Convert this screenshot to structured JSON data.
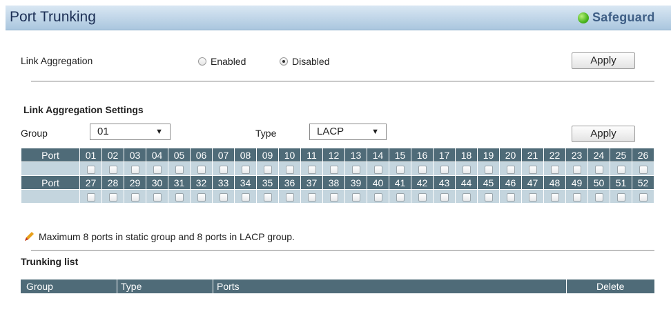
{
  "header": {
    "title": "Port Trunking",
    "brand": "Safeguard"
  },
  "link_aggregation": {
    "label": "Link Aggregation",
    "options": [
      {
        "label": "Enabled",
        "checked": false
      },
      {
        "label": "Disabled",
        "checked": true
      }
    ],
    "apply_label": "Apply"
  },
  "settings": {
    "title": "Link Aggregation Settings",
    "group_label": "Group",
    "group_value": "01",
    "type_label": "Type",
    "type_value": "LACP",
    "apply_label": "Apply"
  },
  "ports_table": {
    "row_label": "Port",
    "rows": [
      [
        "01",
        "02",
        "03",
        "04",
        "05",
        "06",
        "07",
        "08",
        "09",
        "10",
        "11",
        "12",
        "13",
        "14",
        "15",
        "16",
        "17",
        "18",
        "19",
        "20",
        "21",
        "22",
        "23",
        "24",
        "25",
        "26"
      ],
      [
        "27",
        "28",
        "29",
        "30",
        "31",
        "32",
        "33",
        "34",
        "35",
        "36",
        "37",
        "38",
        "39",
        "40",
        "41",
        "42",
        "43",
        "44",
        "45",
        "46",
        "47",
        "48",
        "49",
        "50",
        "51",
        "52"
      ]
    ]
  },
  "note": "Maximum 8 ports in static group and 8 ports in LACP group.",
  "trunking_list": {
    "title": "Trunking list",
    "columns": [
      "Group",
      "Type",
      "Ports",
      "Delete"
    ]
  },
  "colors": {
    "table_header": "#4f6b78",
    "checkbox_row": "#c4d5de",
    "title_text": "#1c2f55",
    "safeguard_dot": "#49b51e"
  }
}
